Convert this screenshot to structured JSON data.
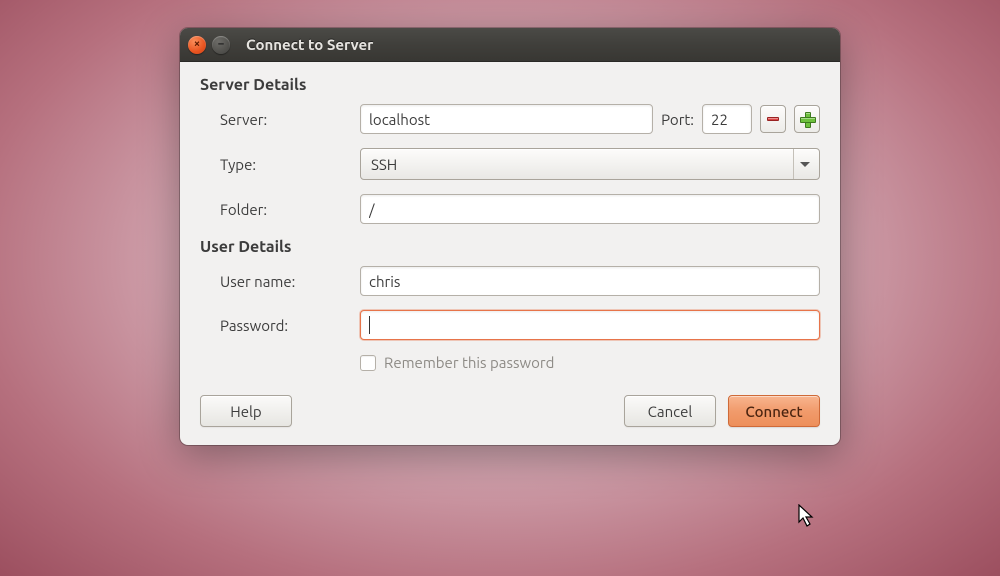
{
  "titlebar": {
    "title": "Connect to Server"
  },
  "sections": {
    "server_details": "Server Details",
    "user_details": "User Details"
  },
  "labels": {
    "server": "Server:",
    "port": "Port:",
    "type": "Type:",
    "folder": "Folder:",
    "username": "User name:",
    "password": "Password:",
    "remember": "Remember this password"
  },
  "values": {
    "server": "localhost",
    "port": "22",
    "type": "SSH",
    "folder": "/",
    "username": "chris",
    "password": ""
  },
  "buttons": {
    "help": "Help",
    "cancel": "Cancel",
    "connect": "Connect"
  },
  "colors": {
    "accent": "#e95420",
    "window_bg": "#f2f1f0"
  }
}
